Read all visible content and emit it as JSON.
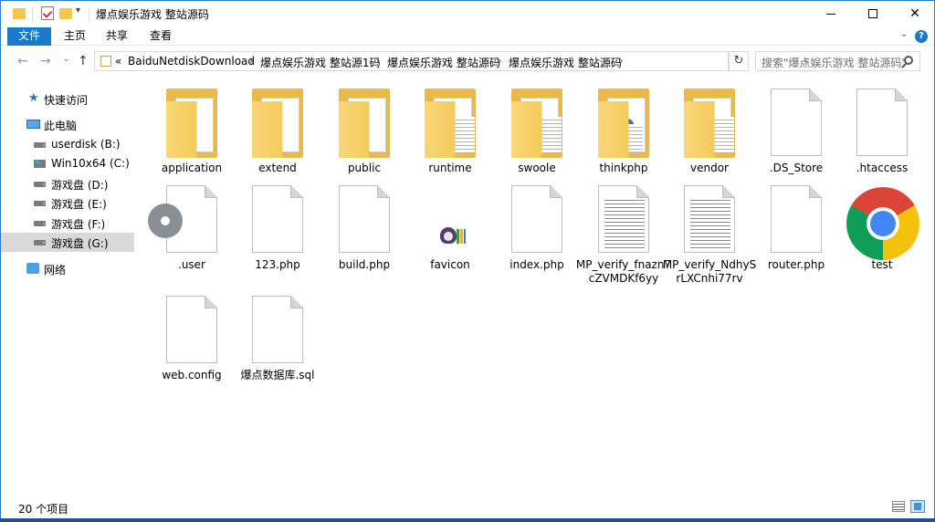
{
  "title_bar": {
    "title": "爆点娱乐游戏 整站源码",
    "qa_dropdown": "▾",
    "minimize": "",
    "maximize": "",
    "close": "✕"
  },
  "ribbon": {
    "file": "文件",
    "home": "主页",
    "share": "共享",
    "view": "查看",
    "expand": "⌄",
    "help": "?"
  },
  "nav": {
    "back": "←",
    "forward": "→",
    "recent": "⌄",
    "up": "↑",
    "refresh": "↻",
    "dropdown": "⌄"
  },
  "address": {
    "overflow": "«",
    "crumbs": [
      "BaiduNetdiskDownload",
      "爆点娱乐游戏 整站源1码",
      "爆点娱乐游戏 整站源码",
      "爆点娱乐游戏 整站源码"
    ],
    "sep": "›"
  },
  "search": {
    "placeholder": "搜索\"爆点娱乐游戏 整站源码\""
  },
  "sidebar": {
    "items": [
      {
        "label": "快速访问",
        "icon": "star-icon"
      },
      {
        "label": "此电脑",
        "icon": "pc-icon"
      },
      {
        "label": "userdisk (B:)",
        "icon": "drive-icon"
      },
      {
        "label": "Win10x64 (C:)",
        "icon": "windows-drive-icon"
      },
      {
        "label": "游戏盘 (D:)",
        "icon": "drive-icon"
      },
      {
        "label": "游戏盘 (E:)",
        "icon": "drive-icon"
      },
      {
        "label": "游戏盘 (F:)",
        "icon": "drive-icon"
      },
      {
        "label": "游戏盘 (G:)",
        "icon": "drive-icon",
        "selected": true
      },
      {
        "label": "网络",
        "icon": "network-icon"
      }
    ]
  },
  "files": [
    {
      "name": "application",
      "type": "folder"
    },
    {
      "name": "extend",
      "type": "folder"
    },
    {
      "name": "public",
      "type": "folder"
    },
    {
      "name": "runtime",
      "type": "folder"
    },
    {
      "name": "swoole",
      "type": "folder"
    },
    {
      "name": "thinkphp",
      "type": "folder"
    },
    {
      "name": "vendor",
      "type": "folder"
    },
    {
      "name": ".DS_Store",
      "type": "file"
    },
    {
      "name": ".htaccess",
      "type": "file"
    },
    {
      "name": ".user",
      "type": "settings"
    },
    {
      "name": "123.php",
      "type": "file"
    },
    {
      "name": "build.php",
      "type": "file"
    },
    {
      "name": "favicon",
      "type": "image"
    },
    {
      "name": "index.php",
      "type": "file"
    },
    {
      "name": "MP_verify_fnazn7cZVMDKf6yy",
      "type": "text"
    },
    {
      "name": "MP_verify_NdhySrLXCnhi77rv",
      "type": "text"
    },
    {
      "name": "router.php",
      "type": "file"
    },
    {
      "name": "test",
      "type": "chrome"
    },
    {
      "name": "web.config",
      "type": "file"
    },
    {
      "name": "爆点数据库.sql",
      "type": "file"
    }
  ],
  "status": {
    "count": "20 个项目"
  },
  "colors": {
    "accent": "#1979ca",
    "folder": "#f3c74f",
    "selected": "#d9d9d9"
  }
}
